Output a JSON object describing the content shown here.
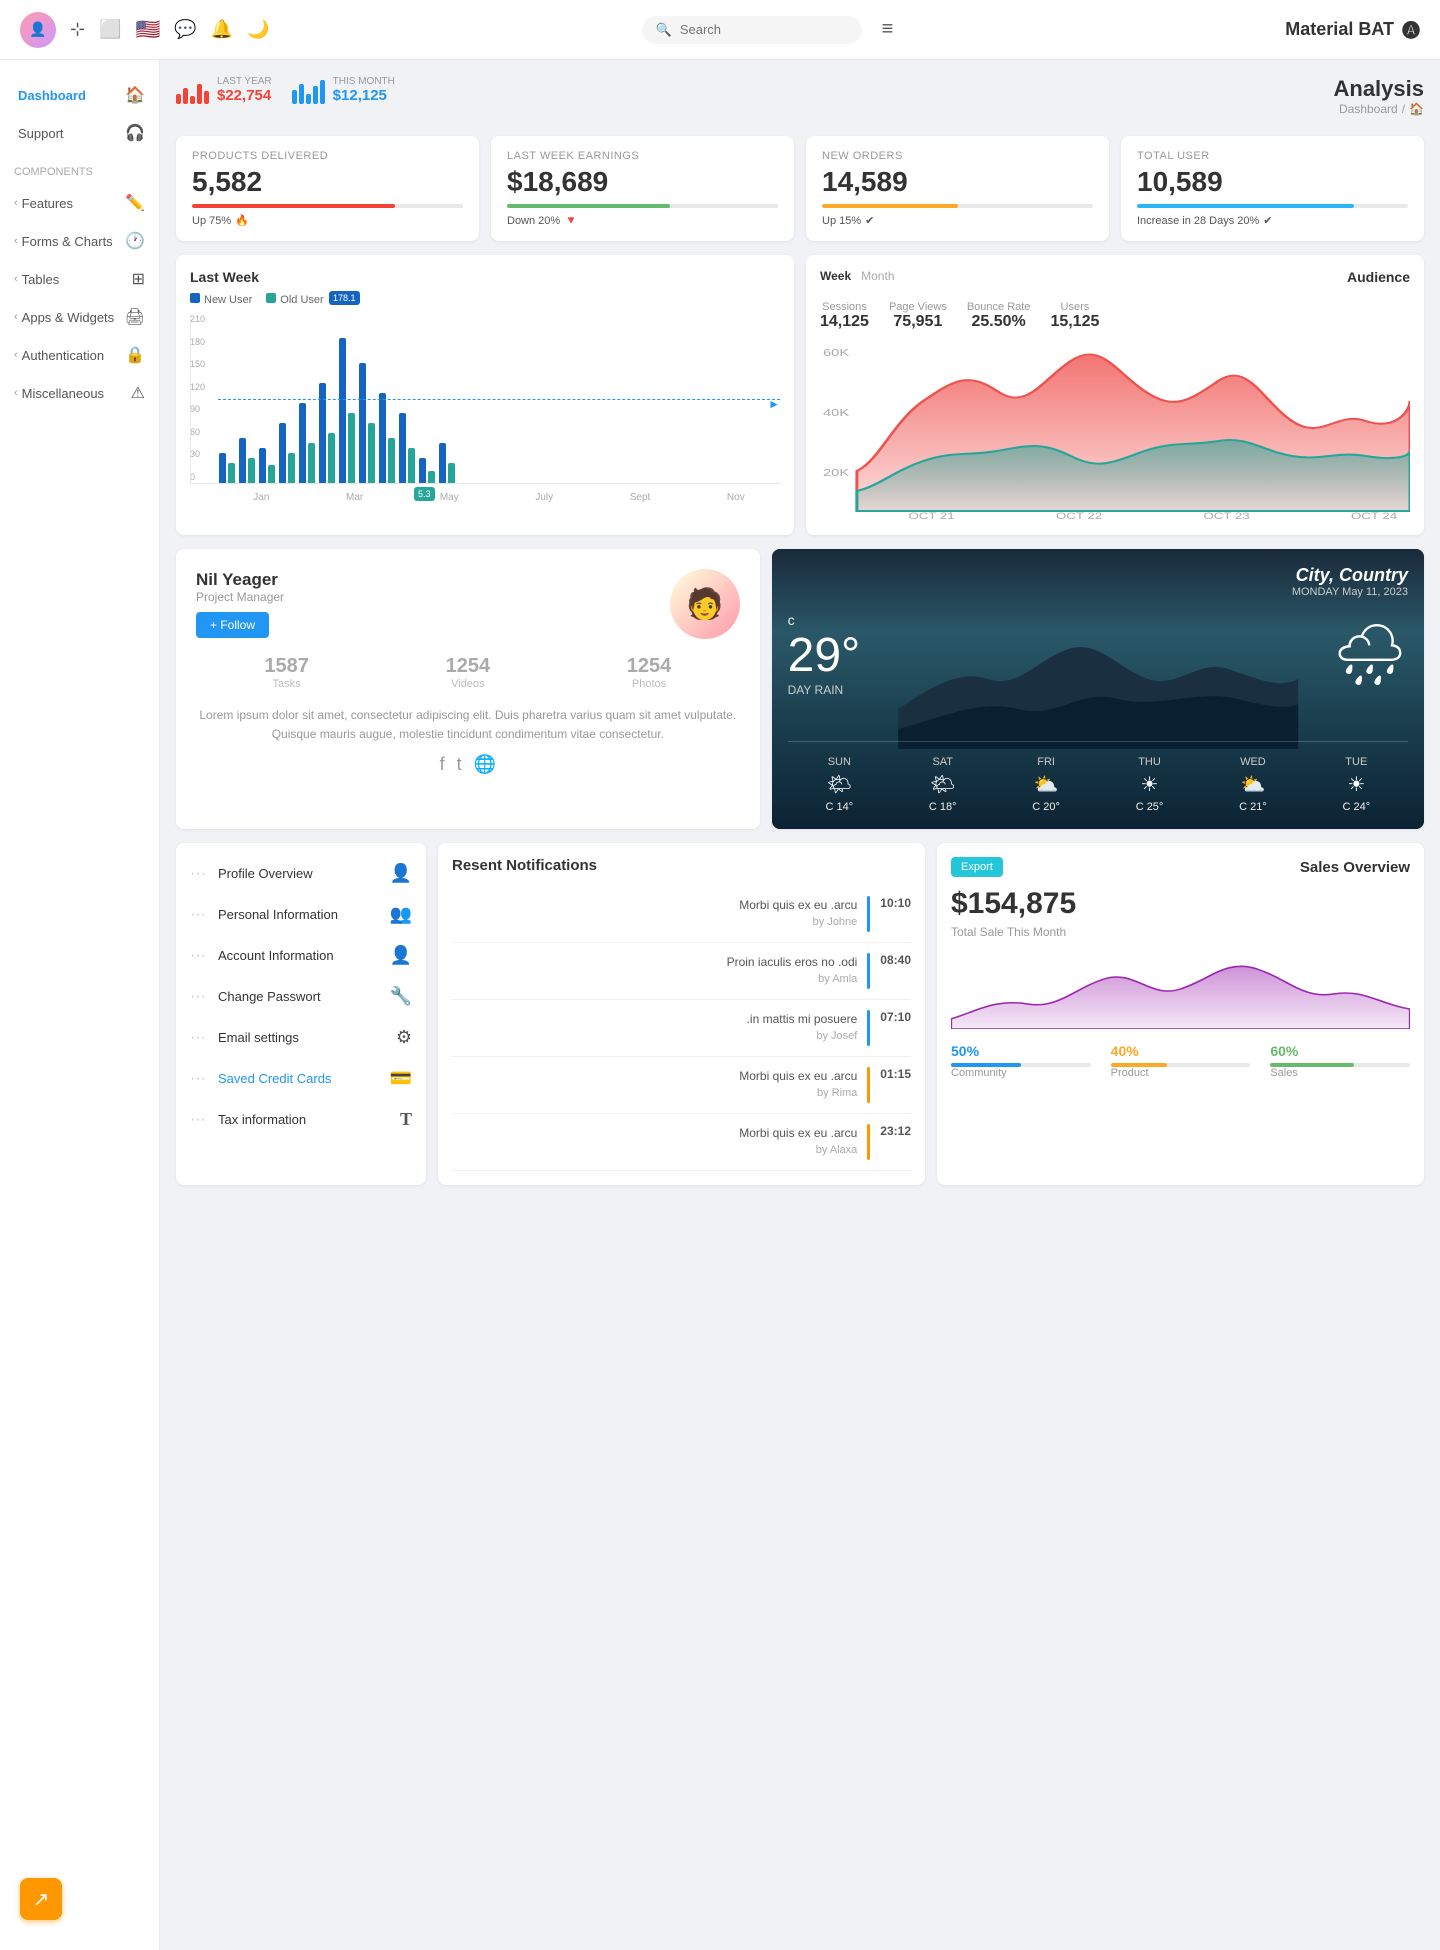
{
  "topbar": {
    "search_placeholder": "Search",
    "hamburger": "≡",
    "brand_name": "Material BAT",
    "brand_icon": "🅜"
  },
  "sidebar": {
    "items": [
      {
        "id": "dashboard",
        "label": "Dashboard",
        "icon": "🏠",
        "active": true,
        "arrow": ""
      },
      {
        "id": "support",
        "label": "Support",
        "icon": "🎧",
        "active": false,
        "arrow": ""
      },
      {
        "id": "components_label",
        "label": "Components",
        "icon": "",
        "section": true
      },
      {
        "id": "features",
        "label": "Features",
        "icon": "✏️",
        "active": false,
        "arrow": "‹"
      },
      {
        "id": "forms_charts",
        "label": "Forms & Charts",
        "icon": "🕐",
        "active": false,
        "arrow": "‹"
      },
      {
        "id": "tables",
        "label": "Tables",
        "icon": "⊞",
        "active": false,
        "arrow": "‹"
      },
      {
        "id": "apps_widgets",
        "label": "Apps & Widgets",
        "icon": "🖨",
        "active": false,
        "arrow": "‹"
      },
      {
        "id": "authentication",
        "label": "Authentication",
        "icon": "🔒",
        "active": false,
        "arrow": "‹"
      },
      {
        "id": "miscellaneous",
        "label": "Miscellaneous",
        "icon": "⚠",
        "active": false,
        "arrow": "‹"
      }
    ]
  },
  "analysis": {
    "title": "Analysis",
    "breadcrumb_home": "Dashboard",
    "breadcrumb_sep": "/"
  },
  "mini_stats": {
    "last_year_label": "LAST YEAR",
    "last_year_value": "$22,754",
    "this_month_label": "THIS MONTH",
    "this_month_value": "$12,125"
  },
  "stat_cards": [
    {
      "label": "PRODUCTS DELIVERED",
      "value": "5,582",
      "bar_color": "#f44336",
      "bar_pct": 75,
      "change_text": "Up 75%",
      "change_icon": "🔥",
      "change_positive": true
    },
    {
      "label": "LAST WEEK EARNINGS",
      "value": "$18,689",
      "bar_color": "#66bb6a",
      "bar_pct": 60,
      "change_text": "Down 20%",
      "change_icon": "🔻",
      "change_positive": false
    },
    {
      "label": "NEW ORDERS",
      "value": "14,589",
      "bar_color": "#ffa726",
      "bar_pct": 50,
      "change_text": "Up 15%",
      "change_icon": "✔",
      "change_positive": true
    },
    {
      "label": "TOTAL USER",
      "value": "10,589",
      "bar_color": "#29b6f6",
      "bar_pct": 80,
      "change_text": "Increase in 28 Days 20%",
      "change_icon": "✔",
      "change_positive": true
    }
  ],
  "bar_chart": {
    "title": "Last Week",
    "legend": [
      "New User",
      "Old User"
    ],
    "legend_colors": [
      "#1565c0",
      "#26a69a"
    ],
    "y_labels": [
      "210",
      "180",
      "150",
      "120",
      "90",
      "60",
      "30",
      "0"
    ],
    "x_labels": [
      "Jan",
      "Mar",
      "May",
      "July",
      "Sept",
      "Nov"
    ],
    "tooltip_value": "178.1",
    "tooltip2_value": "5.3"
  },
  "audience": {
    "title": "Audience",
    "tabs": [
      "Week",
      "Month"
    ],
    "active_tab": "Week",
    "stats": [
      {
        "label": "Sessions",
        "value": "14,125"
      },
      {
        "label": "Page Views",
        "value": "75,951"
      },
      {
        "label": "Bounce Rate",
        "value": "25.50%"
      },
      {
        "label": "Users",
        "value": "15,125"
      }
    ],
    "x_labels": [
      "OCT 21",
      "OCT 22",
      "OCT 23",
      "OCT 24"
    ],
    "y_labels": [
      "60K",
      "40K",
      "20K"
    ]
  },
  "profile": {
    "name": "Nil Yeager",
    "role": "Project Manager",
    "follow_label": "+ Follow",
    "stats": [
      {
        "value": "1587",
        "label": "Tasks"
      },
      {
        "value": "1254",
        "label": "Videos"
      },
      {
        "value": "1254",
        "label": "Photos"
      }
    ],
    "bio": "Lorem ipsum dolor sit amet, consectetur adipiscing elit. Duis pharetra varius quam sit amet vulputate. Quisque mauris augue, molestie tincidunt condimentum vitae consectetur.",
    "social_icons": [
      "f",
      "t",
      "🌐"
    ]
  },
  "weather": {
    "location": "City, Country",
    "date": "MONDAY May 11, 2023",
    "temp": "29°",
    "unit": "c",
    "desc": "DAY RAIN",
    "forecast": [
      {
        "day": "SUN",
        "icon": "🌤",
        "temp": "C 14°"
      },
      {
        "day": "SAT",
        "icon": "🌤",
        "temp": "C 18°"
      },
      {
        "day": "FRI",
        "icon": "⛅",
        "temp": "C 20°"
      },
      {
        "day": "THU",
        "icon": "☀",
        "temp": "C 25°"
      },
      {
        "day": "WED",
        "icon": "⛅",
        "temp": "C 21°"
      },
      {
        "day": "TUE",
        "icon": "☀",
        "temp": "C 24°"
      }
    ]
  },
  "menu_items": [
    {
      "label": "Profile Overview",
      "icon": "👤",
      "blue": false
    },
    {
      "label": "Personal Information",
      "icon": "👥",
      "blue": false
    },
    {
      "label": "Account Information",
      "icon": "👤",
      "blue": false
    },
    {
      "label": "Change Passwort",
      "icon": "🔧",
      "blue": false
    },
    {
      "label": "Email settings",
      "icon": "⚙",
      "blue": false
    },
    {
      "label": "Saved Credit Cards",
      "icon": "💳",
      "blue": true
    },
    {
      "label": "Tax information",
      "icon": "T",
      "blue": false
    }
  ],
  "notifications": {
    "title": "Resent Notifications",
    "items": [
      {
        "text": "Morbi quis ex eu .arcu",
        "by": "by Johne",
        "time": "10:10",
        "bar_color": "#2196f3"
      },
      {
        "text": "Proin iaculis eros no .odi",
        "by": "by Amla",
        "time": "08:40",
        "bar_color": "#2196f3"
      },
      {
        "text": ".in mattis mi posuere",
        "by": "by Josef",
        "time": "07:10",
        "bar_color": "#2196f3"
      },
      {
        "text": "Morbi quis ex eu .arcu",
        "by": "by Rima",
        "time": "01:15",
        "bar_color": "#ff9800"
      },
      {
        "text": "Morbi quis ex eu .arcu",
        "by": "by Alaxa",
        "time": "23:12",
        "bar_color": "#ff9800"
      }
    ]
  },
  "sales": {
    "export_label": "Export",
    "title": "Sales Overview",
    "amount": "$154,875",
    "subtitle": "Total Sale This Month",
    "bars": [
      {
        "label": "Community",
        "pct": "50%",
        "color": "#2196f3",
        "fill": 50
      },
      {
        "label": "Product",
        "pct": "40%",
        "color": "#ffa726",
        "fill": 40
      },
      {
        "label": "Sales",
        "pct": "60%",
        "color": "#66bb6a",
        "fill": 60
      }
    ]
  },
  "fab": {
    "icon": "↗"
  }
}
